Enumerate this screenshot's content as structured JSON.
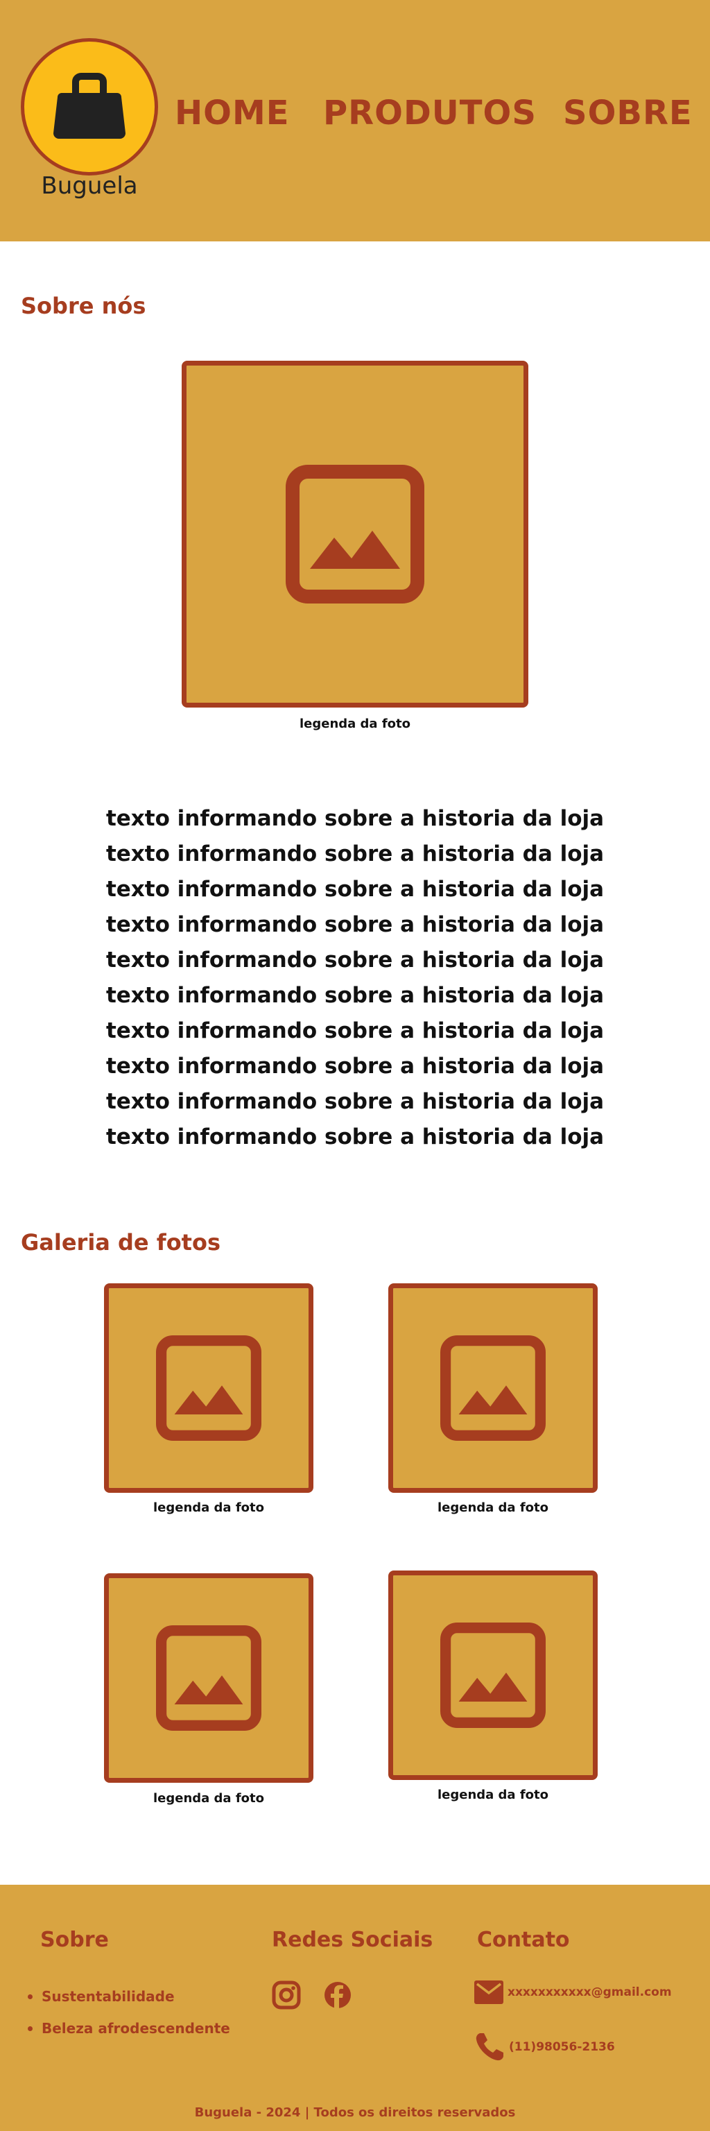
{
  "header": {
    "logo_text": "Buguela",
    "nav": [
      "HOME",
      "PRODUTOS",
      "SOBRE"
    ]
  },
  "about": {
    "title": "Sobre nós",
    "photo_caption": "legenda da foto",
    "story_lines": [
      "texto informando sobre a historia da loja",
      "texto informando sobre a historia da loja",
      "texto informando sobre a historia da loja",
      "texto informando sobre a historia da loja",
      "texto informando sobre a historia da loja",
      "texto informando sobre a historia da loja",
      "texto informando sobre a historia da loja",
      "texto informando sobre a historia da loja",
      "texto informando sobre a historia da loja",
      "texto informando sobre a historia da loja"
    ]
  },
  "gallery": {
    "title": "Galeria de fotos",
    "captions": [
      "legenda da foto",
      "legenda da foto",
      "legenda da foto",
      "legenda da foto"
    ]
  },
  "footer": {
    "sobre_title": "Sobre",
    "sobre_items": [
      "Sustentabilidade",
      "Beleza afrodescendente"
    ],
    "social_title": "Redes Sociais",
    "social_icons": [
      "instagram-icon",
      "facebook-icon"
    ],
    "contact_title": "Contato",
    "email": "xxxxxxxxxxx@gmail.com",
    "phone": "(11)98056-2136",
    "copyright": "Buguela - 2024 | Todos os direitos reservados"
  },
  "colors": {
    "primary": "#d9a441",
    "accent": "#a63d1f",
    "logo_bg": "#fbbc19"
  }
}
